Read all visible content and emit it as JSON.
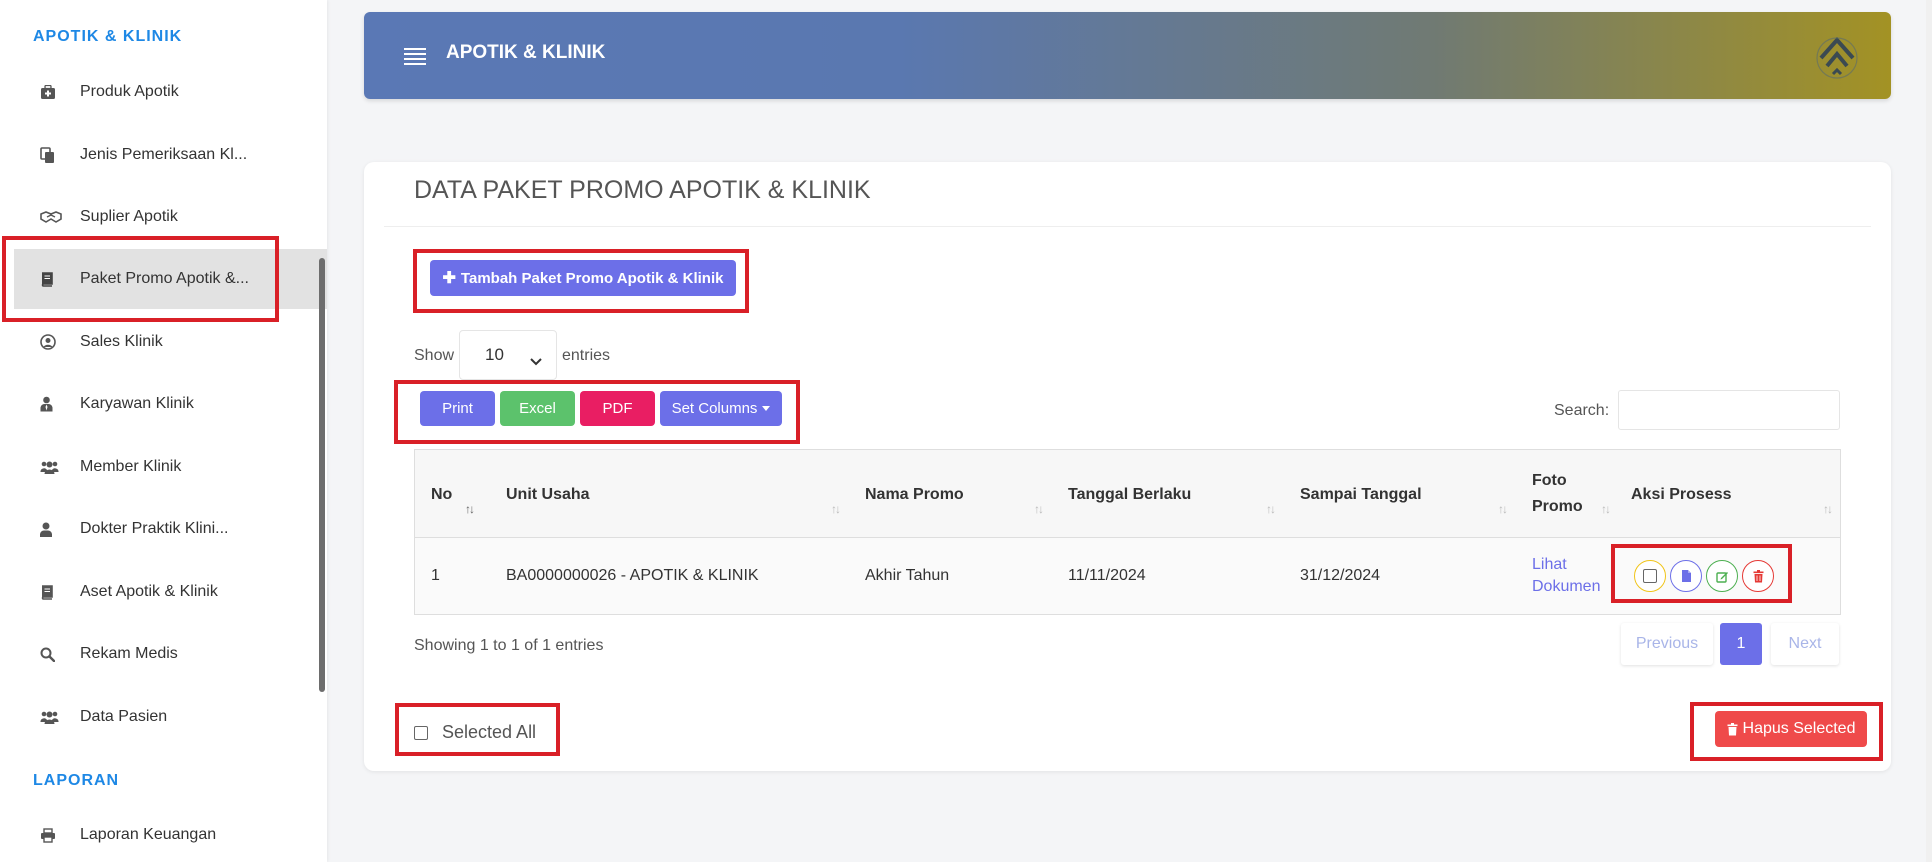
{
  "sidebar": {
    "sections": [
      {
        "label": "APOTIK & KLINIK"
      },
      {
        "label": "LAPORAN"
      }
    ],
    "items": [
      {
        "label": "Produk Apotik",
        "icon": "medkit-icon"
      },
      {
        "label": "Jenis Pemeriksaan Kl...",
        "icon": "copy-icon"
      },
      {
        "label": "Suplier Apotik",
        "icon": "handshake-icon"
      },
      {
        "label": "Paket Promo Apotik &...",
        "icon": "book-icon",
        "active": true
      },
      {
        "label": "Sales Klinik",
        "icon": "user-circle-icon"
      },
      {
        "label": "Karyawan Klinik",
        "icon": "user-tie-icon"
      },
      {
        "label": "Member Klinik",
        "icon": "users-icon"
      },
      {
        "label": "Dokter Praktik Klini...",
        "icon": "user-icon"
      },
      {
        "label": "Aset Apotik & Klinik",
        "icon": "book-icon"
      },
      {
        "label": "Rekam Medis",
        "icon": "search-icon"
      },
      {
        "label": "Data Pasien",
        "icon": "users-icon"
      },
      {
        "label": "Laporan Keuangan",
        "icon": "print-icon"
      }
    ]
  },
  "header": {
    "title": "APOTIK & KLINIK"
  },
  "card": {
    "title": "DATA PAKET PROMO APOTIK & KLINIK",
    "add_button": "Tambah Paket Promo Apotik & Klinik",
    "show_label": "Show",
    "entries_value": "10",
    "entries_label": "entries",
    "export_buttons": {
      "print": "Print",
      "excel": "Excel",
      "pdf": "PDF",
      "set_columns": "Set Columns"
    },
    "search_label": "Search:",
    "search_value": ""
  },
  "table": {
    "headers": {
      "no": "No",
      "unit_usaha": "Unit Usaha",
      "nama_promo": "Nama Promo",
      "tanggal_berlaku": "Tanggal Berlaku",
      "sampai_tanggal": "Sampai Tanggal",
      "foto_promo_1": "Foto",
      "foto_promo_2": "Promo",
      "aksi_proses": "Aksi Prosess"
    },
    "rows": [
      {
        "no": "1",
        "unit_usaha": "BA0000000026 - APOTIK & KLINIK",
        "nama_promo": "Akhir Tahun",
        "tanggal_berlaku": "11/11/2024",
        "sampai_tanggal": "31/12/2024",
        "foto_link_1": "Lihat",
        "foto_link_2": "Dokumen"
      }
    ]
  },
  "footer": {
    "showing": "Showing 1 to 1 of 1 entries",
    "prev": "Previous",
    "page": "1",
    "next": "Next",
    "selected_all": "Selected All",
    "hapus_selected": "Hapus Selected"
  },
  "colors": {
    "accent": "#6c6fe8",
    "sidebar_section": "#1e88e5",
    "highlight": "#d92027",
    "danger": "#ef4a4a",
    "success": "#5cc26c",
    "pdf": "#e91e63"
  }
}
